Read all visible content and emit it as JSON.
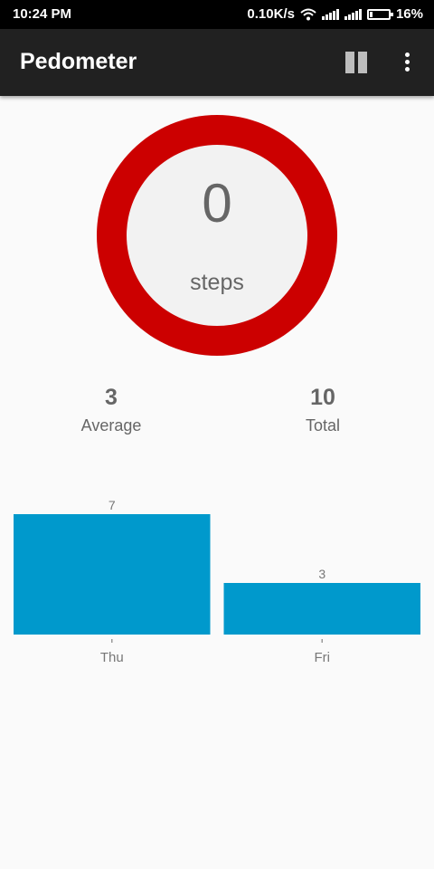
{
  "status_bar": {
    "time": "10:24 PM",
    "network_speed": "0.10K/s",
    "battery": "16%",
    "battery_level": 0.16,
    "icons": [
      "wifi-icon",
      "signal-icon",
      "signal-icon",
      "battery-icon"
    ]
  },
  "app_bar": {
    "title": "Pedometer",
    "icons": [
      "pause-icon",
      "more-vert-icon"
    ]
  },
  "steps": {
    "count": "0",
    "unit": "steps",
    "ring_color": "#cc0000"
  },
  "stats": {
    "average_value": "3",
    "average_label": "Average",
    "total_value": "10",
    "total_label": "Total"
  },
  "chart_data": {
    "type": "bar",
    "categories": [
      "Thu",
      "Fri"
    ],
    "values": [
      7,
      3
    ],
    "value_labels": [
      "7",
      "3"
    ],
    "bar_color": "#0099cc",
    "ylim": [
      0,
      7
    ],
    "title": "",
    "xlabel": "",
    "ylabel": "",
    "grid": false
  }
}
